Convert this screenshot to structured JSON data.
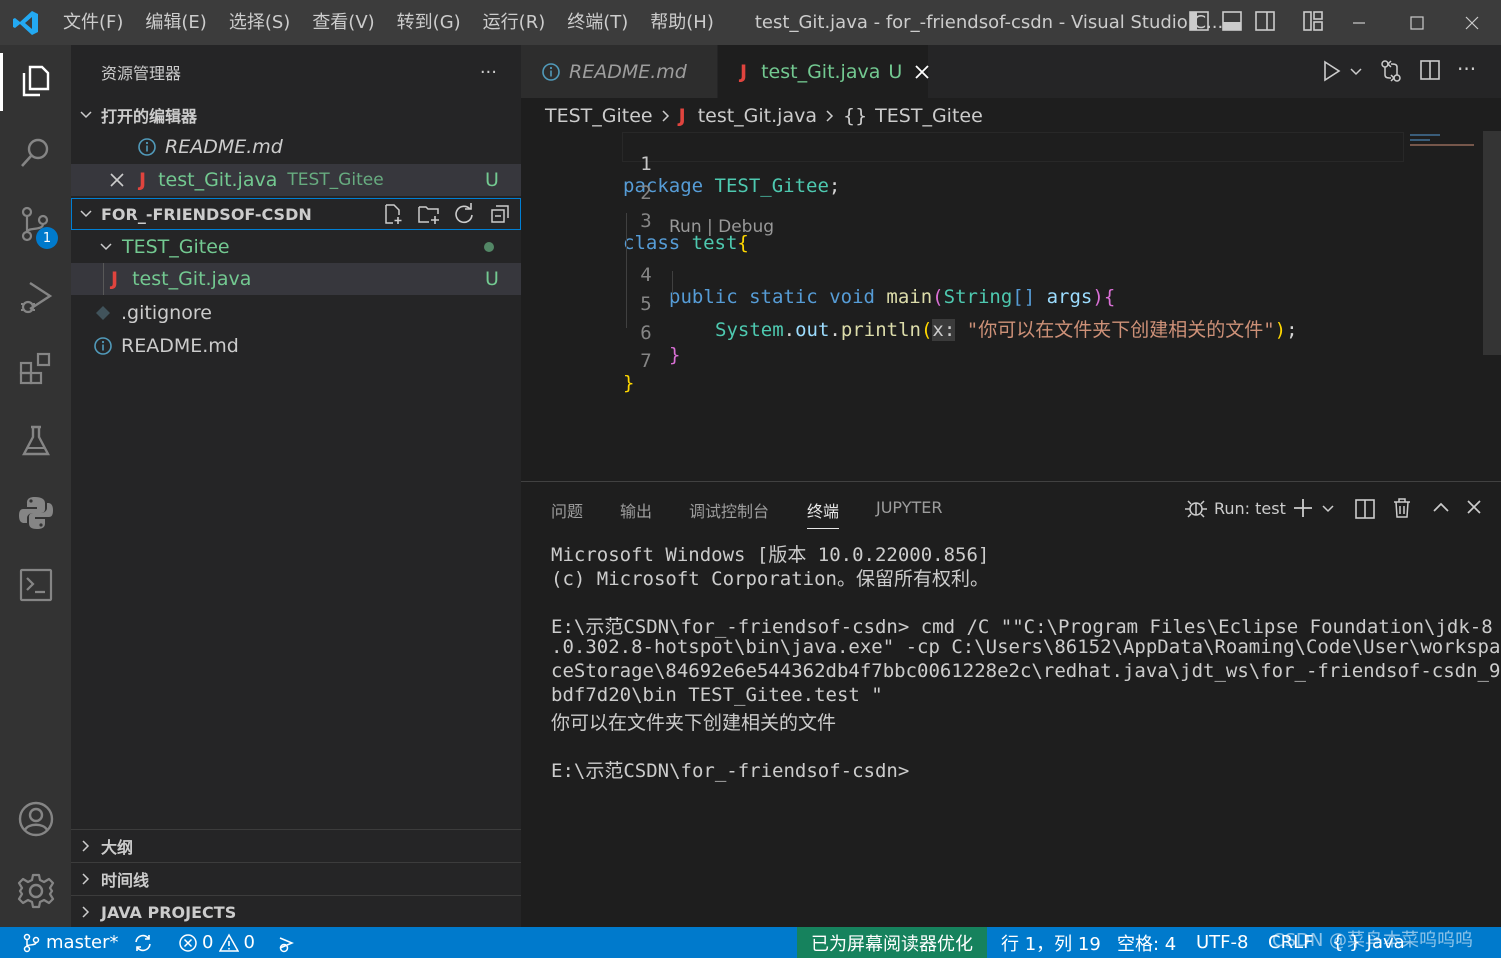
{
  "titlebar": {
    "menus": [
      "文件(F)",
      "编辑(E)",
      "选择(S)",
      "查看(V)",
      "转到(G)",
      "运行(R)",
      "终端(T)",
      "帮助(H)"
    ],
    "window_title": "test_Git.java - for_-friendsof-csdn - Visual Studio C..."
  },
  "activitybar": {
    "scm_badge": "1",
    "icons": [
      "explorer-icon",
      "search-icon",
      "source-control-icon",
      "run-debug-icon",
      "extensions-icon",
      "testing-icon",
      "python-icon",
      "terminal-icon",
      "account-icon",
      "settings-gear-icon"
    ]
  },
  "sidebar": {
    "title": "资源管理器",
    "more": "···",
    "open_editors": {
      "header": "打开的编辑器",
      "items": [
        {
          "name": "README.md",
          "italic": true
        },
        {
          "name": "test_Git.java",
          "folder": "TEST_Gitee",
          "status": "U"
        }
      ]
    },
    "workspace": {
      "header": "FOR_-FRIENDSOF-CSDN",
      "tree": [
        {
          "name": "TEST_Gitee"
        },
        {
          "name": "test_Git.java",
          "status": "U"
        },
        {
          "name": ".gitignore"
        },
        {
          "name": "README.md"
        }
      ]
    },
    "bottom_sections": [
      "大纲",
      "时间线",
      "JAVA PROJECTS"
    ]
  },
  "editor": {
    "tabs": [
      {
        "label": "README.md",
        "active": false
      },
      {
        "label": "test_Git.java",
        "status": "U",
        "active": true
      }
    ],
    "breadcrumb": [
      "TEST_Gitee",
      "test_Git.java",
      "TEST_Gitee"
    ],
    "breadcrumb_symbol": "{}",
    "codelens": "Run | Debug",
    "line_numbers": [
      "1",
      "2",
      "3",
      "4",
      "5",
      "6",
      "7"
    ],
    "code": {
      "package_kw": "package",
      "package_name": "TEST_Gitee",
      "class_kw": "class",
      "class_name": "test",
      "public_kw": "public",
      "static_kw": "static",
      "void_kw": "void",
      "main_fn": "main",
      "string_type": "String",
      "args_param": "args",
      "system": "System",
      "out": "out",
      "println": "println",
      "hint": "x:",
      "string_literal": "\"你可以在文件夹下创建相关的文件\""
    }
  },
  "panel": {
    "tabs": [
      "问题",
      "输出",
      "调试控制台",
      "终端",
      "JUPYTER"
    ],
    "active_tab": "终端",
    "run_label": "Run: test",
    "terminal_lines": [
      "Microsoft Windows [版本 10.0.22000.856]",
      "(c) Microsoft Corporation。保留所有权利。",
      "",
      "E:\\示范CSDN\\for_-friendsof-csdn> cmd /C \"\"C:\\Program Files\\Eclipse Foundation\\jdk-8",
      ".0.302.8-hotspot\\bin\\java.exe\" -cp C:\\Users\\86152\\AppData\\Roaming\\Code\\User\\workspa",
      "ceStorage\\84692e6e544362db4f7bbc0061228e2c\\redhat.java\\jdt_ws\\for_-friendsof-csdn_9",
      "bdf7d20\\bin TEST_Gitee.test \"",
      "你可以在文件夹下创建相关的文件",
      "",
      "E:\\示范CSDN\\for_-friendsof-csdn>"
    ]
  },
  "statusbar": {
    "branch": "master*",
    "errors": "0",
    "warnings": "0",
    "screen_reader": "已为屏幕阅读器优化",
    "position": "行 1，列 19",
    "spaces": "空格: 4",
    "encoding": "UTF-8",
    "eol": "CRLF",
    "language": "Java",
    "watermark": "CSDN @菜鸟本菜呜呜呜"
  },
  "colors": {
    "accent": "#007acc",
    "untracked": "#73c991",
    "java_icon": "#e0443e"
  }
}
